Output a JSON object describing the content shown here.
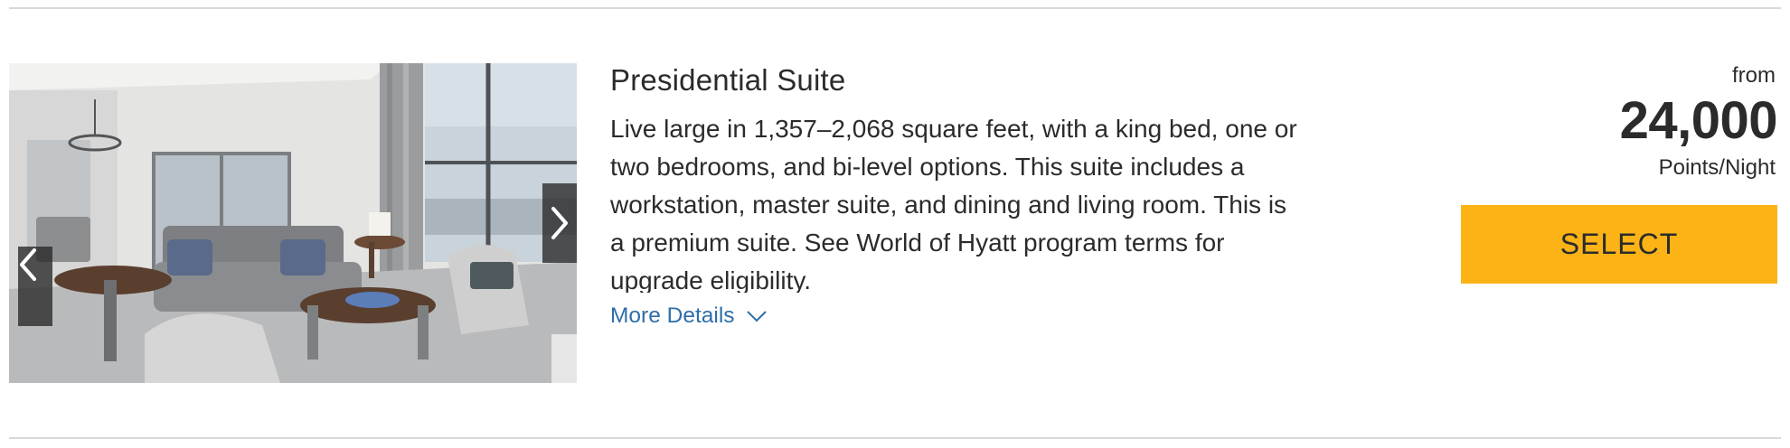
{
  "room": {
    "title": "Presidential Suite",
    "description": "Live large in 1,357–2,068 square feet, with a king bed, one or two bedrooms, and bi-level options. This suite includes a workstation, master suite, and dining and living room. This is a premium suite. See World of Hyatt program terms for upgrade eligibility.",
    "more_details_label": "More Details",
    "photo_alt": "Presidential Suite living room"
  },
  "price": {
    "from_label": "from",
    "value": "24,000",
    "unit": "Points/Night"
  },
  "select_label": "SELECT",
  "icons": {
    "carousel_prev": "chevron-left-icon",
    "carousel_next": "chevron-right-icon",
    "more_details": "chevron-down-icon"
  },
  "colors": {
    "accent_select": "#fcb316",
    "link": "#2e6eaa",
    "text": "#2b2b2b",
    "divider": "#d9d9d9"
  }
}
